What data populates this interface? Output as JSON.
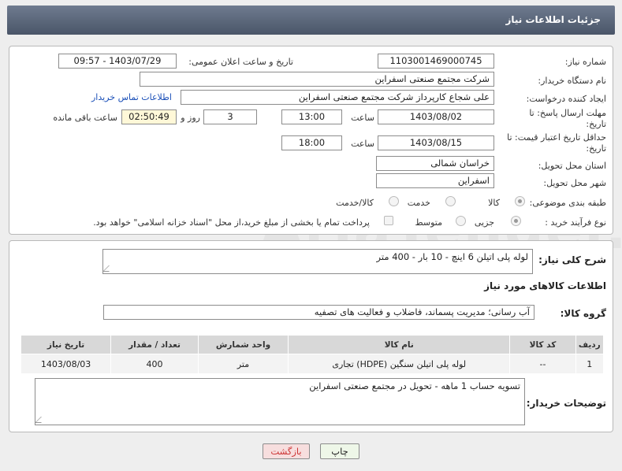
{
  "header": {
    "title": "جزئیات اطلاعات نیاز"
  },
  "form": {
    "need_number": {
      "label": "شماره نیاز:",
      "value": "1103001469000745"
    },
    "announce_datetime": {
      "label": "تاریخ و ساعت اعلان عمومی:",
      "value": "1403/07/29 - 09:57"
    },
    "buyer_org": {
      "label": "نام دستگاه خریدار:",
      "value": "شرکت مجتمع صنعتی اسفراین"
    },
    "requester": {
      "label": "ایجاد کننده درخواست:",
      "value": "علی شجاع کارپرداز شرکت مجتمع صنعتی اسفراین",
      "contact_link": "اطلاعات تماس خریدار"
    },
    "reply_deadline": {
      "label": "مهلت ارسال پاسخ: تا تاریخ:",
      "date": "1403/08/02",
      "time_label": "ساعت",
      "time": "13:00",
      "days": "3",
      "days_label": "روز و",
      "remaining": "02:50:49",
      "remaining_label": "ساعت باقی مانده"
    },
    "price_validity": {
      "label": "حداقل تاریخ اعتبار قیمت: تا تاریخ:",
      "date": "1403/08/15",
      "time_label": "ساعت",
      "time": "18:00"
    },
    "province": {
      "label": "استان محل تحویل:",
      "value": "خراسان شمالی"
    },
    "city": {
      "label": "شهر محل تحویل:",
      "value": "اسفراین"
    },
    "category": {
      "label": "طبقه بندی موضوعی:",
      "options": [
        "کالا",
        "خدمت",
        "کالا/خدمت"
      ],
      "selected": "کالا"
    },
    "purchase_type": {
      "label": "نوع فرآیند خرید :",
      "options": [
        "جزیی",
        "متوسط"
      ],
      "selected": "جزیی",
      "payment_note": "پرداخت تمام یا بخشی از مبلغ خرید،از محل \"اسناد خزانه اسلامی\" خواهد بود."
    }
  },
  "summary": {
    "label": "شرح کلی نیاز:",
    "value": "لوله پلی اتیلن 6 اینچ - 10 بار - 400 متر"
  },
  "goods_info": {
    "title": "اطلاعات کالاهای مورد نیاز",
    "group_label": "گروه کالا:",
    "group_value": "آب رسانی؛ مدیریت پسماند، فاضلاب و فعالیت های تصفیه"
  },
  "table": {
    "headers": [
      "ردیف",
      "کد کالا",
      "نام کالا",
      "واحد شمارش",
      "تعداد / مقدار",
      "تاریخ نیاز"
    ],
    "rows": [
      [
        "1",
        "--",
        "لوله پلی اتیلن سنگین (HDPE) تجاری",
        "متر",
        "400",
        "1403/08/03"
      ]
    ]
  },
  "buyer_notes": {
    "label": "توضیحات خریدار:",
    "value": "تسویه حساب 1 ماهه - تحویل در مجتمع صنعتی اسفراین"
  },
  "buttons": {
    "print": "چاپ",
    "back": "بازگشت"
  },
  "colors": {
    "header_bg": "#55606f",
    "link": "#1a4fb8",
    "back_button_bg": "#f7dede",
    "print_button_bg": "#eef7e8"
  }
}
